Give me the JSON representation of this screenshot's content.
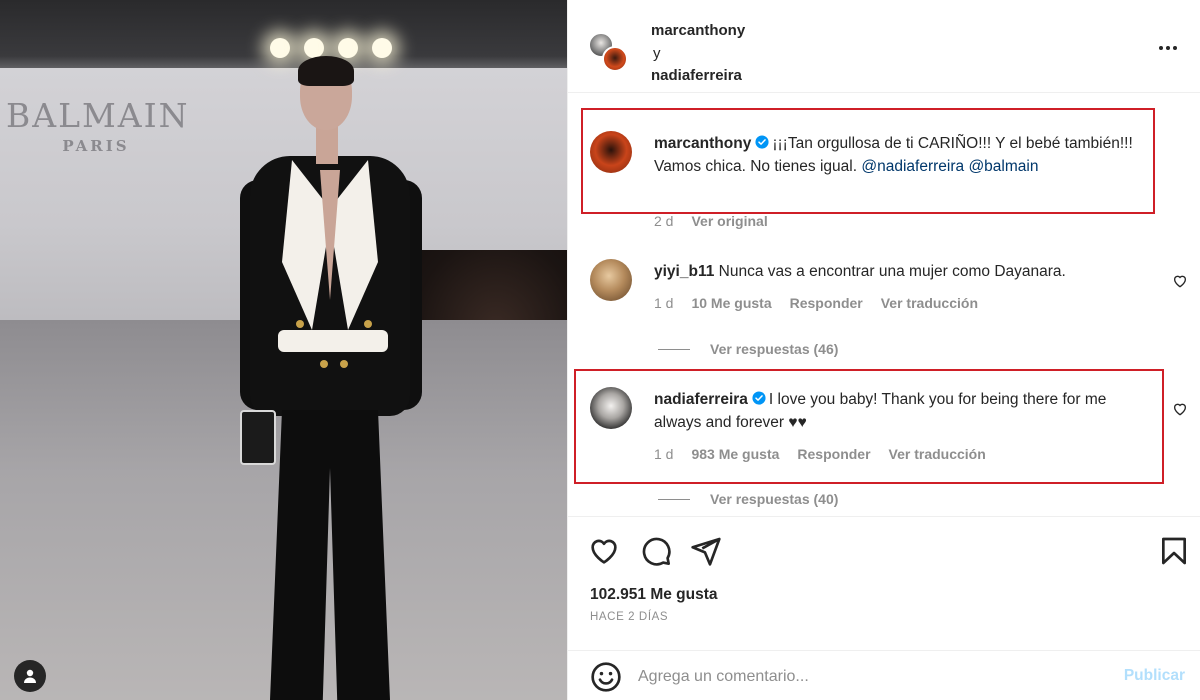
{
  "photo": {
    "brand_name": "BALMAIN",
    "brand_city": "PARIS"
  },
  "header": {
    "user1": "marcanthony",
    "connector": "y",
    "user2": "nadiaferreira"
  },
  "comments": [
    {
      "username": "marcanthony",
      "verified": true,
      "text": "¡¡¡Tan orgullosa de ti CARIÑO!!! Y el bebé también!!! Vamos chica. No tienes igual.",
      "mentions": [
        "@nadiaferreira",
        "@balmain"
      ],
      "time": "2 d",
      "translate": "Ver original"
    },
    {
      "username": "yiyi_b11",
      "verified": false,
      "text": "Nunca vas a encontrar una mujer como Dayanara.",
      "time": "1 d",
      "likes": "10 Me gusta",
      "reply": "Responder",
      "translate": "Ver traducción",
      "view_replies": "Ver respuestas (46)"
    },
    {
      "username": "nadiaferreira",
      "verified": true,
      "text": "I love you baby! Thank you for being there for me always and forever ♥♥",
      "time": "1 d",
      "likes": "983 Me gusta",
      "reply": "Responder",
      "translate": "Ver traducción",
      "view_replies": "Ver respuestas (40)"
    }
  ],
  "stats": {
    "likes": "102.951 Me gusta",
    "time_ago": "HACE 2 DÍAS"
  },
  "composer": {
    "placeholder": "Agrega un comentario...",
    "post_label": "Publicar"
  },
  "colors": {
    "highlight": "#cf1f27",
    "verified": "#0095f6",
    "mention": "#00376b",
    "post_disabled": "#b2dffc"
  },
  "icons": [
    "heart-icon",
    "comment-icon",
    "share-icon",
    "bookmark-icon",
    "emoji-icon",
    "more-icon",
    "verified-icon",
    "profile-icon"
  ]
}
